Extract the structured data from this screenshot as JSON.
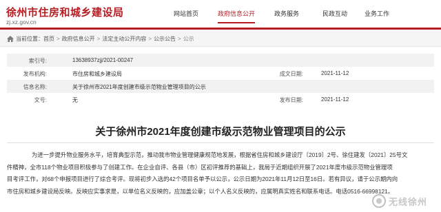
{
  "header": {
    "site_title": "徐州市住房和城乡建设局",
    "site_url": "zj.xz.gov.cn",
    "nav": [
      {
        "label": "网站首页"
      },
      {
        "label": "政府信息公开"
      },
      {
        "label": "政务服务"
      },
      {
        "label": "民政互动"
      },
      {
        "label": "业务工作"
      }
    ],
    "accent_color": "#b51d22"
  },
  "breadcrumb": {
    "prefix": "当前位置：",
    "items": [
      "首页",
      "政府信息公开",
      "法定主动公开内容",
      "公示公告",
      "公示"
    ],
    "separator": ">"
  },
  "info": {
    "index_label": "索引号:",
    "index_value": "13638937zjj/2021-00247",
    "publisher_label": "发布机构:",
    "publisher_value": "市住房和城乡建设局",
    "created_label": "成文日期:",
    "created_value": "2021-11-12",
    "name_label": "信息名称:",
    "name_value": "关于徐州市2021年度创建市级示范物业管理项目的公示",
    "docno_label": "文号:",
    "docno_value": "无",
    "published_label": "发布日期:",
    "published_value": "2021-11-12"
  },
  "article": {
    "title": "关于徐州市2021年度创建市级示范物业管理项目的公示",
    "lines": [
      "为进一步提升物业服务水平，培育典型示范，推动我市物业管理健康规范地发展，根据省住房和城乡建设厅〔2019〕2号、徐住建发〔2021〕25号文",
      "件精神，全市118个物业项目积极参与了创建工作。在企业自评、各县（市）区初评推荐的基础上，我局于近期组织开展了2021年度市级示范物业管理项",
      "目考评工作，对68个申报项目进行了综合考评。现将初步入选的42个项目名单予以公示，公示日期为2021年11月12日至16日。若有异议，请于公示期内向",
      "市住房和城乡建设局反映。反映应实事求是，以单位名义反映的，应加盖公章；以个人名义反映的，应属明真实姓名和联系电话。电话0516-66998121。"
    ]
  },
  "watermark": {
    "text": "无线徐州"
  }
}
